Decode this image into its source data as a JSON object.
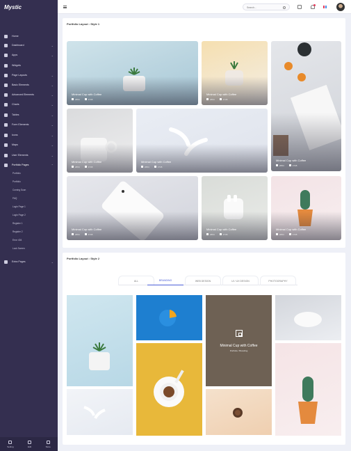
{
  "app": {
    "logo": "Mystic"
  },
  "sidebar": {
    "items": [
      {
        "label": "Home",
        "chevron": false
      },
      {
        "label": "Dashboard",
        "chevron": true
      },
      {
        "label": "Apps",
        "chevron": true
      },
      {
        "label": "Widgets",
        "chevron": false
      },
      {
        "label": "Page Layouts",
        "chevron": true
      },
      {
        "label": "Basic Elements",
        "chevron": true
      },
      {
        "label": "Advanced Elements",
        "chevron": true
      },
      {
        "label": "Charts",
        "chevron": true
      },
      {
        "label": "Tables",
        "chevron": true
      },
      {
        "label": "Form Elements",
        "chevron": true
      },
      {
        "label": "Icons",
        "chevron": true
      },
      {
        "label": "Maps",
        "chevron": true
      },
      {
        "label": "User Elements",
        "chevron": true
      },
      {
        "label": "Portfolio Pages",
        "chevron": true
      }
    ],
    "subitems": [
      "Portfolio",
      "Portfolio",
      "Coming Soon",
      "FAQ",
      "Login Page 1",
      "Login Page 2",
      "Register 1",
      "Register 2",
      "Error 404",
      "Lock Screen"
    ],
    "extra": {
      "label": "Extra Pages"
    },
    "footer": [
      "Setting",
      "Edit",
      "Store"
    ]
  },
  "topbar": {
    "search_placeholder": "Search..."
  },
  "style1": {
    "title": "Portfolio Layout : Style 1",
    "tiles": [
      {
        "caption": "Minimal Cup with Coffee",
        "likes": "2654",
        "comments": "1745"
      },
      {
        "caption": "Minimal Cup with Coffee",
        "likes": "2654",
        "comments": "1745"
      },
      {
        "caption": "Minimal Cup with Coffee",
        "likes": "2654",
        "comments": "1745"
      },
      {
        "caption": "Minimal Cup with Coffee",
        "likes": "2654",
        "comments": "1745"
      },
      {
        "caption": "Minimal Cup with Coffee",
        "likes": "2654",
        "comments": "1745"
      },
      {
        "caption": "Minimal Cup with Coffee",
        "likes": "2654",
        "comments": "1745"
      },
      {
        "caption": "Minimal Cup with Coffee",
        "likes": "2654",
        "comments": "1745"
      },
      {
        "caption": "Minimal Cup with Coffee",
        "likes": "2654",
        "comments": "1745"
      },
      {
        "caption": "Minimal Cup with Coffee",
        "likes": "2654",
        "comments": "1745"
      }
    ]
  },
  "style2": {
    "title": "Portfolio Layout : Style 2",
    "tabs": [
      "ALL",
      "BRANDING",
      "WEB DESIGN",
      "UI / UX DESIGN",
      "PHOTOGRAPHY"
    ],
    "active_tab": 1,
    "overlay": {
      "title": "Minimal Cup with Coffee",
      "subtitle": "Portfolio / Branding"
    }
  },
  "colors": {
    "sidebar": "#342f50",
    "accent": "#4b5ed7",
    "background": "#eef0f7"
  }
}
